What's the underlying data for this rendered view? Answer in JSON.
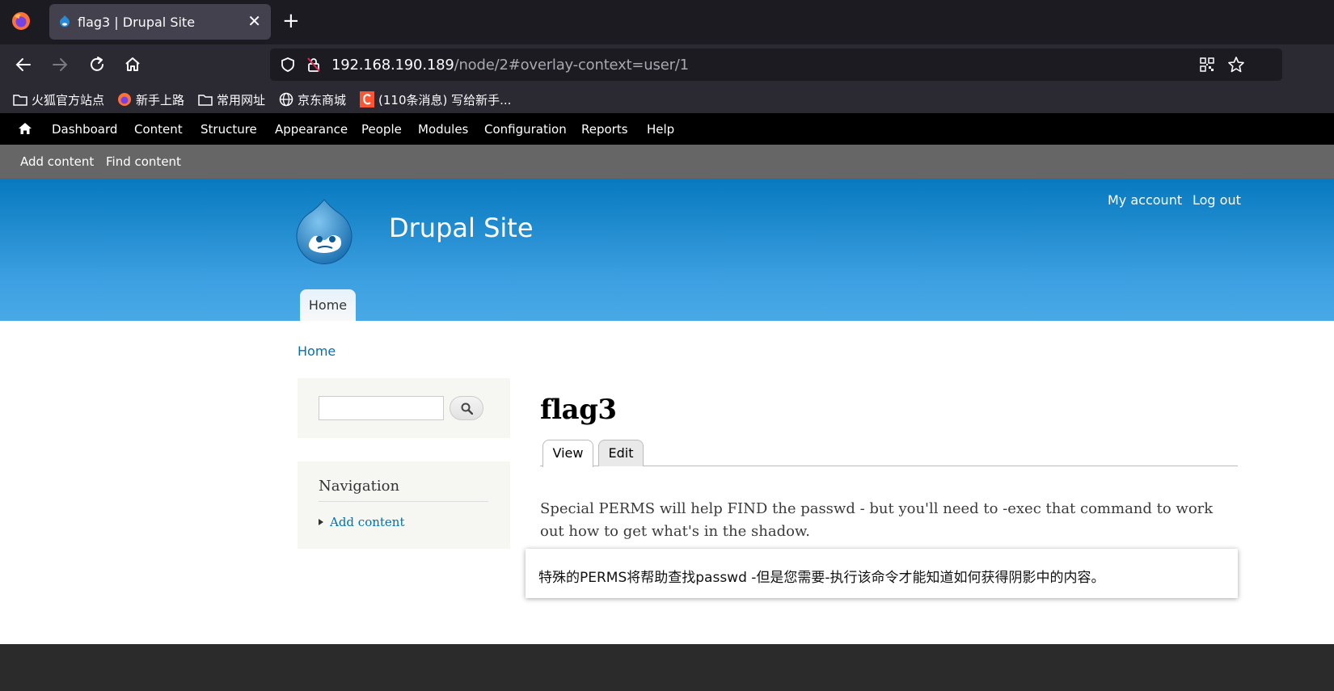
{
  "browser": {
    "tab_title": "flag3 | Drupal Site",
    "tab_close": "✕",
    "new_tab": "+",
    "url_host": "192.168.190.189",
    "url_path": "/node/2#overlay-context=user/1",
    "bookmarks": [
      {
        "label": "火狐官方站点",
        "icon": "folder-icon"
      },
      {
        "label": "新手上路",
        "icon": "firefox-icon"
      },
      {
        "label": "常用网址",
        "icon": "folder-icon"
      },
      {
        "label": "京东商城",
        "icon": "globe-icon"
      },
      {
        "label": "(110条消息) 写给新手...",
        "icon": "csdn-icon"
      }
    ]
  },
  "toolbar": {
    "items": [
      "Dashboard",
      "Content",
      "Structure",
      "Appearance",
      "People",
      "Modules",
      "Configuration",
      "Reports",
      "Help"
    ]
  },
  "shortcuts": {
    "items": [
      "Add content",
      "Find content"
    ]
  },
  "header": {
    "site_name": "Drupal Site",
    "secondary_menu": [
      "My account",
      "Log out"
    ],
    "main_menu": [
      "Home"
    ]
  },
  "breadcrumb": "Home",
  "sidebar": {
    "search_value": "",
    "navigation_title": "Navigation",
    "navigation_links": [
      "Add content"
    ]
  },
  "content": {
    "title": "flag3",
    "tabs": [
      "View",
      "Edit"
    ],
    "body": "Special PERMS will help FIND the passwd - but you'll need to -exec that command to work out how to get what's in the shadow."
  },
  "translation_popup": {
    "text": "特殊的PERMS将帮助查找passwd -但是您需要-执行该命令才能知道如何获得阴影中的内容。"
  },
  "colors": {
    "header_top": "#0779bf",
    "header_bottom": "#48a9e6",
    "link": "#0071b3",
    "toolbar": "#000000",
    "shortcut_bar": "#666666"
  }
}
